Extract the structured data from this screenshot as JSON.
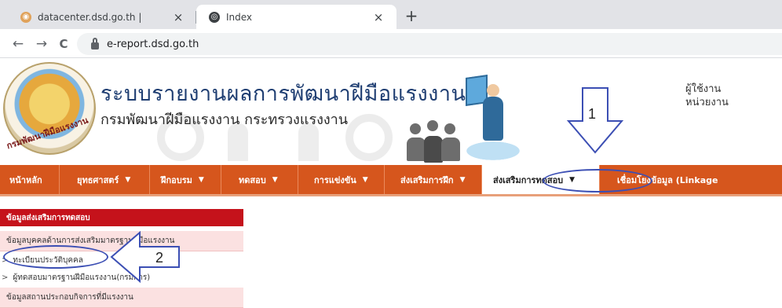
{
  "browser": {
    "tabs": [
      {
        "title": "datacenter.dsd.go.th |",
        "close": "×",
        "favicon": "globe-orange-icon"
      },
      {
        "title": "Index",
        "close": "×",
        "favicon": "globe-icon"
      }
    ],
    "new_tab": "+",
    "back": "←",
    "forward": "→",
    "reload": "C",
    "url": "e-report.dsd.go.th"
  },
  "header": {
    "site_title": "ระบบรายงานผลการพัฒนาฝีมือแรงงาน",
    "site_subtitle": "กรมพัฒนาฝีมือแรงงาน กระทรวงแรงงาน",
    "logo_text": "กรมพัฒนาฝีมือแรงงาน",
    "user_label": "ผู้ใช้งาน",
    "unit_label": "หน่วยงาน"
  },
  "nav": {
    "items": [
      {
        "label": "หน้าหลัก",
        "caret": ""
      },
      {
        "label": "ยุทธศาสตร์",
        "caret": "▼"
      },
      {
        "label": "ฝึกอบรม",
        "caret": "▼"
      },
      {
        "label": "ทดสอบ",
        "caret": "▼"
      },
      {
        "label": "การแข่งขัน",
        "caret": "▼"
      },
      {
        "label": "ส่งเสริมการฝึก",
        "caret": "▼"
      },
      {
        "label": "ส่งเสริมการทดสอบ",
        "caret": "▼"
      },
      {
        "label": "เชื่อมโยงข้อมูล (Linkage",
        "caret": ""
      }
    ],
    "active_index": 6
  },
  "sidebar": {
    "heading": "ข้อมูลส่งเสริมการทดสอบ",
    "group1": "ข้อมูลบุคคลด้านการส่งเสริมมาตรฐานฝีมือแรงงาน",
    "links": [
      {
        "arrow": ">",
        "label": "ทะเบียนประวัติบุคคล"
      },
      {
        "arrow": ">",
        "label": "ผู้ทดสอบมาตรฐานฝีมือแรงงาน(กรมการ)"
      }
    ],
    "group2": "ข้อมูลสถานประกอบกิจการที่มีแรงงาน"
  },
  "annotations": {
    "step1": "1",
    "step2": "2"
  },
  "colors": {
    "nav_bg": "#d6561d",
    "sidebar_heading": "#c5121b",
    "annotation": "#3c4fb4",
    "title_blue": "#1f3e72"
  }
}
